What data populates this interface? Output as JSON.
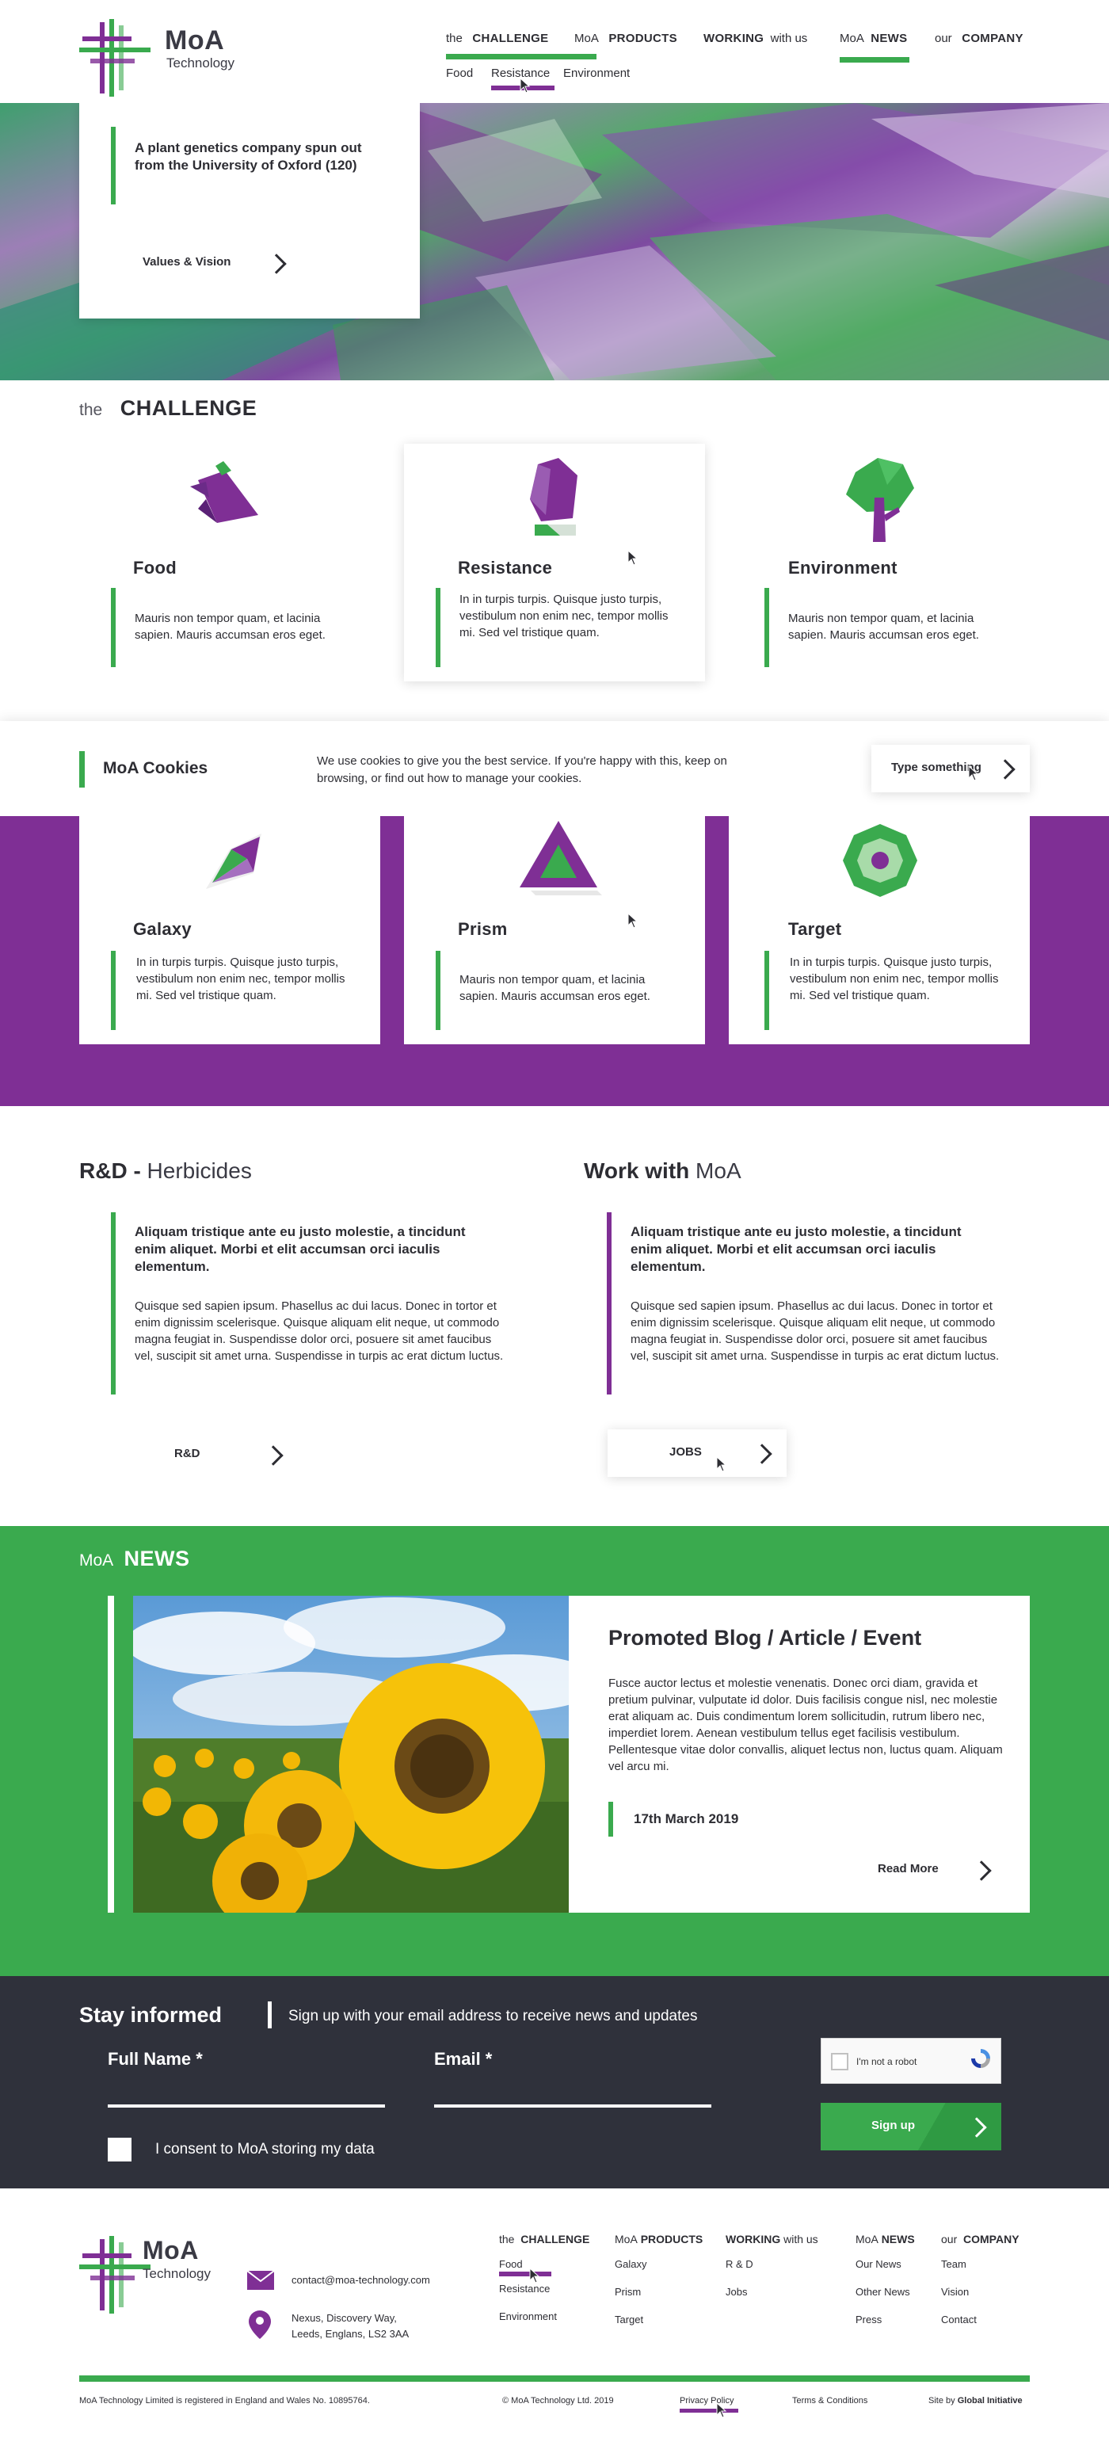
{
  "header": {
    "logo": {
      "word": "MoA",
      "sub": "Technology"
    },
    "nav": [
      {
        "pre": "the",
        "main": "CHALLENGE"
      },
      {
        "pre": "MoA",
        "main": "PRODUCTS"
      },
      {
        "pre": "with us",
        "main": "WORKING"
      },
      {
        "pre": "MoA",
        "main": "NEWS"
      },
      {
        "pre": "our",
        "main": "COMPANY"
      }
    ],
    "subnav": [
      "Food",
      "Resistance",
      "Environment"
    ]
  },
  "hero": {
    "tagline": "A plant genetics company spun out from the University of Oxford (120)",
    "values_label": "Values & Vision"
  },
  "challenge": {
    "pre": "the",
    "title": "CHALLENGE",
    "cards": [
      {
        "title": "Food",
        "text": "Mauris non tempor quam, et lacinia sapien. Mauris accumsan eros eget.",
        "icon": "food-icon"
      },
      {
        "title": "Resistance",
        "text": "In in turpis turpis. Quisque justo turpis, vestibulum non enim nec, tempor mollis mi. Sed vel tristique quam.",
        "icon": "resistance-icon"
      },
      {
        "title": "Environment",
        "text": "Mauris non tempor quam, et lacinia sapien. Mauris accumsan eros eget.",
        "icon": "tree-icon"
      }
    ]
  },
  "cookies": {
    "title": "MoA Cookies",
    "text": "We use cookies to give you the best service. If you're happy with this, keep on browsing, or find out how to manage your cookies.",
    "button": "Type something"
  },
  "products": {
    "cards": [
      {
        "title": "Galaxy",
        "text": "In in turpis turpis. Quisque justo turpis, vestibulum non enim nec, tempor mollis mi. Sed vel tristique quam.",
        "icon": "galaxy-icon"
      },
      {
        "title": "Prism",
        "text": "Mauris non tempor quam, et lacinia sapien. Mauris accumsan eros eget.",
        "icon": "prism-icon"
      },
      {
        "title": "Target",
        "text": "In in turpis turpis. Quisque justo turpis, vestibulum non enim nec, tempor mollis mi. Sed vel tristique quam.",
        "icon": "target-icon"
      }
    ]
  },
  "rd": {
    "title_bold": "R&D -",
    "title_light": "Herbicides",
    "lead": "Aliquam tristique ante eu justo molestie, a tincidunt enim aliquet. Morbi et elit accumsan orci iaculis elementum.",
    "body": "Quisque sed sapien ipsum. Phasellus ac dui lacus. Donec in tortor et enim dignissim scelerisque. Quisque aliquam elit neque, ut commodo magna feugiat in. Suspendisse dolor orci, posuere sit amet faucibus vel, suscipit sit amet urna. Suspendisse in turpis ac erat dictum luctus.",
    "button": "R&D"
  },
  "work": {
    "title_bold": "Work with",
    "title_light": "MoA",
    "lead": "Aliquam tristique ante eu justo molestie, a tincidunt enim aliquet. Morbi et elit accumsan orci iaculis elementum.",
    "body": "Quisque sed sapien ipsum. Phasellus ac dui lacus. Donec in tortor et enim dignissim scelerisque. Quisque aliquam elit neque, ut commodo magna feugiat in. Suspendisse dolor orci, posuere sit amet faucibus vel, suscipit sit amet urna. Suspendisse in turpis ac erat dictum luctus.",
    "button": "JOBS"
  },
  "news": {
    "pre": "MoA",
    "title": "NEWS",
    "article_title": "Promoted Blog / Article / Event",
    "article_text": "Fusce auctor lectus et molestie venenatis. Donec orci diam, gravida et pretium pulvinar, vulputate id dolor. Duis facilisis congue nisl, nec molestie erat aliquam ac. Duis condimentum lorem sollicitudin, rutrum libero nec, imperdiet lorem. Aenean vestibulum tellus eget facilisis vestibulum. Pellentesque vitae dolor convallis, aliquet lectus non, luctus quam. Aliquam vel arcu mi.",
    "date": "17th March 2019",
    "read_more": "Read More"
  },
  "signup": {
    "title": "Stay informed",
    "subtitle": "Sign up with your email address to receive news and updates",
    "full_name_label": "Full Name *",
    "email_label": "Email *",
    "consent": "I consent to MoA storing my data",
    "captcha": "I'm not a robot",
    "button": "Sign up"
  },
  "footer": {
    "logo": {
      "word": "MoA",
      "sub": "Technology"
    },
    "email": "contact@moa-technology.com",
    "address_line1": "Nexus, Discovery Way,",
    "address_line2": "Leeds, Englans, LS2 3AA",
    "columns": [
      {
        "pre": "the",
        "main": "CHALLENGE",
        "links": [
          "Food",
          "Resistance",
          "Environment"
        ]
      },
      {
        "pre": "MoA",
        "main": "PRODUCTS",
        "links": [
          "Galaxy",
          "Prism",
          "Target"
        ]
      },
      {
        "pre": "with us",
        "main": "WORKING",
        "links": [
          "R & D",
          "Jobs"
        ]
      },
      {
        "pre": "MoA",
        "main": "NEWS",
        "links": [
          "Our News",
          "Other News",
          "Press"
        ]
      },
      {
        "pre": "our",
        "main": "COMPANY",
        "links": [
          "Team",
          "Vision",
          "Contact"
        ]
      }
    ],
    "registered": "MoA Technology Limited is registered in England and Wales No. 10895764.",
    "copyright": "© MoA Technology Ltd. 2019",
    "privacy": "Privacy Policy",
    "terms": "Terms & Conditions",
    "site_by_pre": "Site by",
    "site_by": "Global Initiative"
  },
  "colors": {
    "green": "#3aaa4e",
    "purple": "#7f2f95",
    "dark": "#2f313b"
  }
}
